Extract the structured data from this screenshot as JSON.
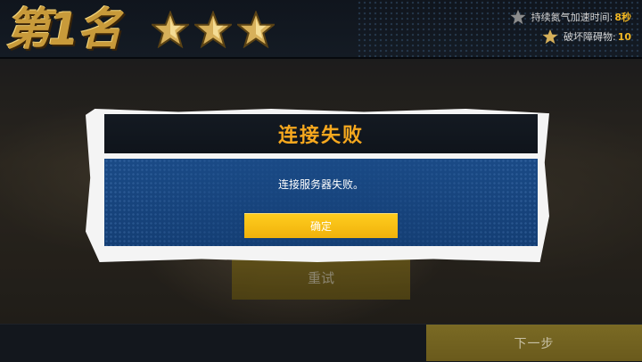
{
  "header": {
    "rank_text": "第1名",
    "stars": [
      {
        "icon": "gold-star-icon"
      },
      {
        "icon": "gold-star-icon"
      },
      {
        "icon": "gold-star-icon"
      }
    ],
    "stats": [
      {
        "icon": "grey-star-icon",
        "label": "持续氮气加速时间:",
        "value": "8秒"
      },
      {
        "icon": "gold-star-icon",
        "label": "破坏障碍物:",
        "value": "10"
      }
    ]
  },
  "background_buttons": {
    "retry_label": "重试",
    "next_label": "下一步"
  },
  "dialog": {
    "title": "连接失败",
    "message": "连接服务器失败。",
    "confirm_label": "确定"
  },
  "colors": {
    "title_orange": "#f6a81e",
    "dialog_blue": "#1a4a86",
    "button_yellow": "#ffce1f",
    "stat_value_gold": "#f2b824"
  }
}
